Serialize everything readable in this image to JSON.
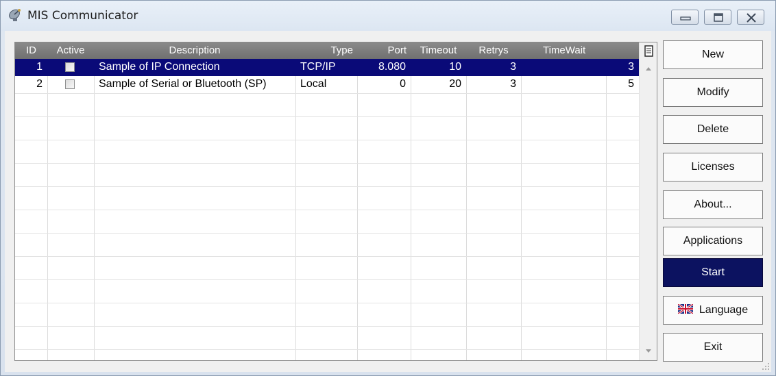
{
  "window": {
    "title": "MIS Communicator",
    "icon": "satellite-dish-icon",
    "controls": [
      {
        "name": "minimize-icon"
      },
      {
        "name": "maximize-icon"
      },
      {
        "name": "close-icon"
      }
    ]
  },
  "grid": {
    "columns": [
      "ID",
      "Active",
      "Description",
      "Type",
      "Port",
      "Timeout",
      "Retrys",
      "TimeWait"
    ],
    "column_menu_icon": "column-chooser-icon",
    "rows": [
      {
        "id": "1",
        "active": false,
        "description": "Sample of IP Connection",
        "type": "TCP/IP",
        "port": "8.080",
        "timeout": "10",
        "retrys": "3",
        "timewait": "3",
        "selected": true
      },
      {
        "id": "2",
        "active": false,
        "description": "Sample of Serial or Bluetooth (SP)",
        "type": "Local",
        "port": "0",
        "timeout": "20",
        "retrys": "3",
        "timewait": "5",
        "selected": false
      }
    ],
    "selected_color": "#0a0a78",
    "header_color": "#7c7c7c"
  },
  "buttons": {
    "new": "New",
    "modify": "Modify",
    "delete": "Delete",
    "licenses": "Licenses",
    "about": "About...",
    "applications": "Applications",
    "start": "Start",
    "language": "Language",
    "exit": "Exit",
    "start_color": "#0c1260",
    "language_icon": "uk-flag-icon"
  }
}
